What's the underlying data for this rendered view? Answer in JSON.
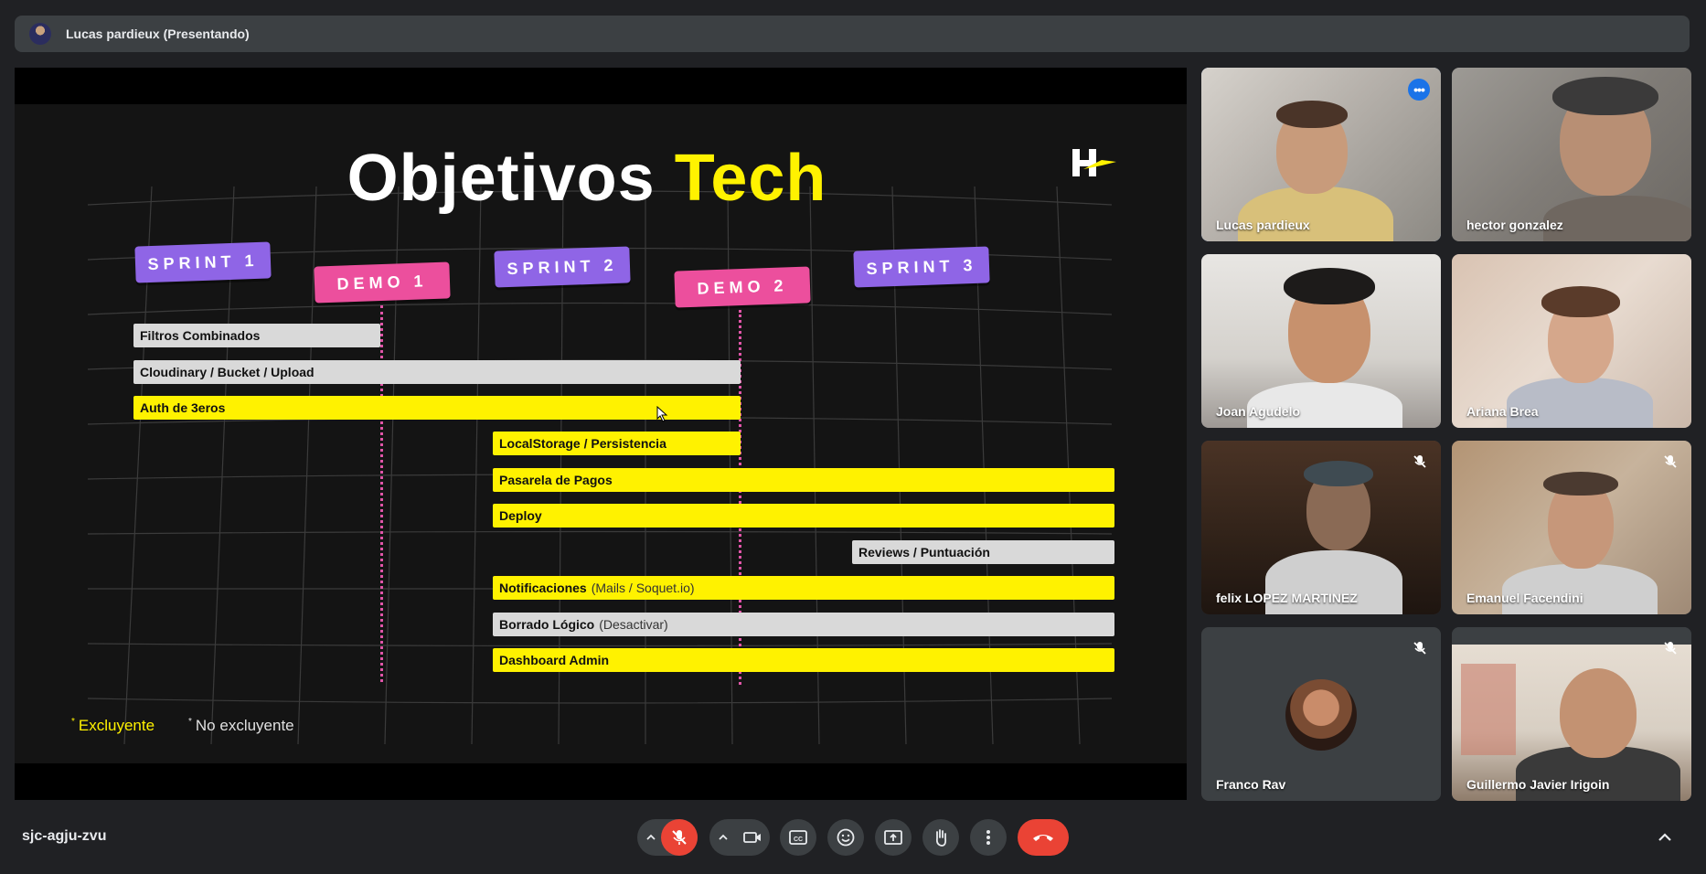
{
  "presenter_bar": {
    "label": "Lucas pardieux (Presentando)"
  },
  "slide": {
    "title_part1": "Objetivos",
    "title_part2": "Tech",
    "badges": [
      "SPRINT 1",
      "DEMO 1",
      "SPRINT 2",
      "DEMO 2",
      "SPRINT 3"
    ],
    "tasks": [
      {
        "label": "Filtros Combinados",
        "sub": "",
        "required": false
      },
      {
        "label": "Cloudinary / Bucket / Upload",
        "sub": "",
        "required": false
      },
      {
        "label": "Auth de 3eros",
        "sub": "",
        "required": true
      },
      {
        "label": "LocalStorage / Persistencia",
        "sub": "",
        "required": true
      },
      {
        "label": "Pasarela de Pagos",
        "sub": "",
        "required": true
      },
      {
        "label": "Deploy",
        "sub": "",
        "required": true
      },
      {
        "label": "Reviews / Puntuación",
        "sub": "",
        "required": false
      },
      {
        "label": "Notificaciones",
        "sub": "(Mails / Soquet.io)",
        "required": true
      },
      {
        "label": "Borrado Lógico",
        "sub": "(Desactivar)",
        "required": false
      },
      {
        "label": "Dashboard Admin",
        "sub": "",
        "required": true
      }
    ],
    "legend_required": "Excluyente",
    "legend_optional": "No excluyente",
    "colors": {
      "yellow": "#fff200",
      "sprint": "#8f65e6",
      "demo": "#ec4f9d",
      "gray": "#d9d9d9"
    }
  },
  "participants": [
    {
      "name": "Lucas pardieux",
      "muted": false,
      "active": true
    },
    {
      "name": "hector gonzalez",
      "muted": false,
      "active": false
    },
    {
      "name": "Joan Agudelo",
      "muted": false,
      "active": false
    },
    {
      "name": "Ariana Brea",
      "muted": false,
      "active": false
    },
    {
      "name": "felix LOPEZ MARTINEZ",
      "muted": true,
      "active": false
    },
    {
      "name": "Emanuel Facendini",
      "muted": true,
      "active": false
    },
    {
      "name": "Franco Rav",
      "muted": true,
      "active": false
    },
    {
      "name": "Guillermo Javier Irigoin",
      "muted": true,
      "active": false
    }
  ],
  "bottom_bar": {
    "meeting_code": "sjc-agju-zvu",
    "controls": [
      "mic-off-icon",
      "camera-icon",
      "captions-icon",
      "emoji-icon",
      "present-icon",
      "raise-hand-icon",
      "more-options-icon",
      "end-call-icon"
    ]
  }
}
